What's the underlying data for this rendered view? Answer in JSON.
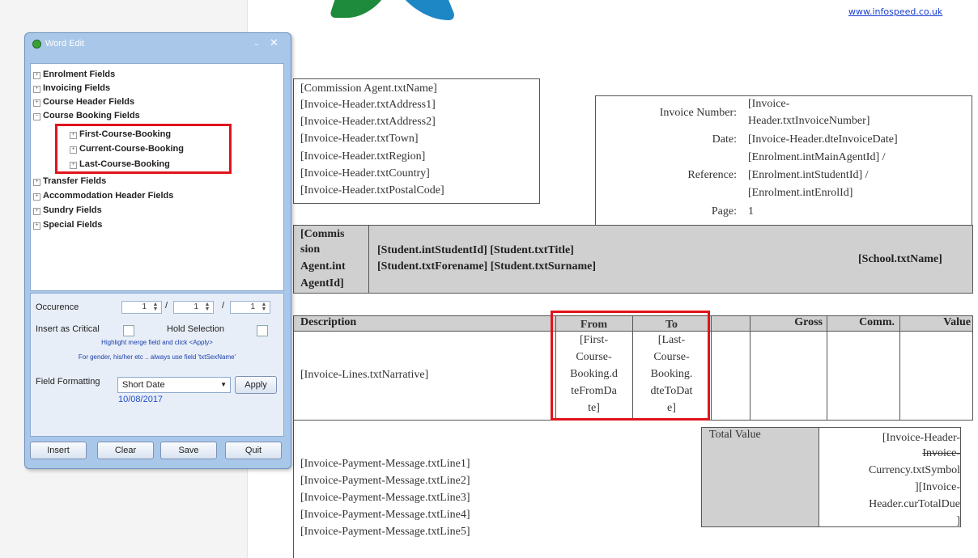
{
  "website": "www.infospeed.co.uk",
  "dialog": {
    "title": "Word Edit",
    "tree": [
      {
        "label": "Enrolment Fields",
        "level": 0
      },
      {
        "label": "Invoicing Fields",
        "level": 0
      },
      {
        "label": "Course Header Fields",
        "level": 0
      },
      {
        "label": "Course Booking Fields",
        "level": 0
      },
      {
        "label": "First-Course-Booking",
        "level": 1
      },
      {
        "label": "Current-Course-Booking",
        "level": 1
      },
      {
        "label": "Last-Course-Booking",
        "level": 1
      },
      {
        "label": "Transfer Fields",
        "level": 0
      },
      {
        "label": "Accommodation Header Fields",
        "level": 0
      },
      {
        "label": "Sundry Fields",
        "level": 0
      },
      {
        "label": "Special Fields",
        "level": 0
      }
    ],
    "occurence_label": "Occurence",
    "occurence_values": [
      "1",
      "1",
      "1"
    ],
    "insert_critical_label": "Insert as Critical",
    "hold_selection_label": "Hold Selection",
    "hint1": "Highlight merge field and click <Apply>",
    "hint2": "For gender, his/her etc .. always use field 'txtSexName'",
    "field_formatting_label": "Field Formatting",
    "field_formatting_value": "Short Date",
    "apply_label": "Apply",
    "preview_date": "10/08/2017",
    "buttons": {
      "insert": "Insert",
      "clear": "Clear",
      "save": "Save",
      "quit": "Quit"
    }
  },
  "doc": {
    "address_lines": [
      "[Commission Agent.txtName]",
      "[Invoice-Header.txtAddress1]",
      "[Invoice-Header.txtAddress2]",
      "[Invoice-Header.txtTown]",
      "[Invoice-Header.txtRegion]",
      "[Invoice-Header.txtCountry]",
      "[Invoice-Header.txtPostalCode]"
    ],
    "invoice_info": {
      "number_label": "Invoice Number:",
      "number_value": [
        "[Invoice-",
        "Header.txtInvoiceNumber]"
      ],
      "date_label": "Date:",
      "date_value": "[Invoice-Header.dteInvoiceDate]",
      "reference_label": "Reference:",
      "reference_value": [
        "[Enrolment.intMainAgentId] /",
        "[Enrolment.intStudentId] /",
        "[Enrolment.intEnrolId]"
      ],
      "page_label": "Page:",
      "page_value": "1"
    },
    "agent_cell": [
      "[Commis",
      "sion",
      "Agent.int",
      "AgentId]"
    ],
    "student_line1": "[Student.intStudentId] [Student.txtTitle]",
    "student_line2": "[Student.txtForename] [Student.txtSurname]",
    "school": "[School.txtName]",
    "table_headers": {
      "description": "Description",
      "from": "From",
      "to": "To",
      "gross": "Gross",
      "comm": "Comm.",
      "value": "Value"
    },
    "narrative": "[Invoice-Lines.txtNarrative]",
    "from_value": [
      "[First-",
      "Course-",
      "Booking.d",
      "teFromDa",
      "te]"
    ],
    "to_value": [
      "[Last-",
      "Course-",
      "Booking.",
      "dteToDat",
      "e]"
    ],
    "total_label": "Total Value",
    "total_value": [
      "[Invoice-Header-",
      "Invoice-",
      "Currency.txtSymbol",
      "][Invoice-",
      "Header.curTotalDue",
      "]"
    ],
    "payment_lines": [
      "[Invoice-Payment-Message.txtLine1]",
      "[Invoice-Payment-Message.txtLine2]",
      "[Invoice-Payment-Message.txtLine3]",
      "[Invoice-Payment-Message.txtLine4]",
      "[Invoice-Payment-Message.txtLine5]"
    ]
  },
  "colors": {
    "highlight": "#e0141c",
    "gray_cell": "#d0d0d0",
    "dialog_frame": "#a9c7e8",
    "link": "#1a3fcc"
  }
}
